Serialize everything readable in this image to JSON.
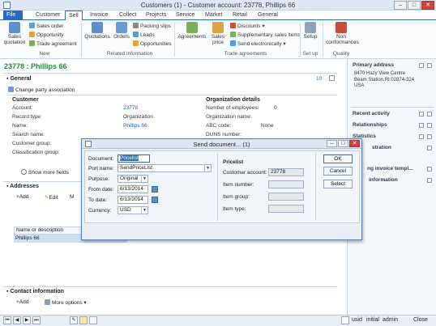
{
  "window": {
    "title": "Customers (1) - Customer account: 23778, Phillips 66",
    "min": "–",
    "max": "□",
    "close": "✕"
  },
  "ribbon_tabs": [
    "File",
    "Customer",
    "Sell",
    "Invoice",
    "Collect",
    "Projects",
    "Service",
    "Market",
    "Retail",
    "General"
  ],
  "ribbon": {
    "new": {
      "sales_quotation": "Sales quotation",
      "sales_order": "Sales order",
      "opportunity": "Opportunity",
      "trade_agreement": "Trade agreement",
      "label": "New"
    },
    "related": {
      "quotations": "Quotations",
      "orders": "Orders",
      "packing_slips": "Packing slips",
      "leads": "Leads",
      "opportunities": "Opportunities",
      "label": "Related information"
    },
    "trade": {
      "agreements": "Agreements",
      "sales_price": "Sales price",
      "discounts": "Discounts",
      "supplementary": "Supplementary sales items",
      "send_electronically": "Send electronically",
      "label": "Trade agreements"
    },
    "setup": {
      "setup": "Setup",
      "label": "Set up"
    },
    "quality": {
      "nonconf": "Non conformances",
      "label": "Quality"
    }
  },
  "record_heading": "23778 : Phillips 66",
  "general": {
    "title": "General",
    "count": "10",
    "change_party": "Change party association",
    "customer_hdr": "Customer",
    "org_hdr": "Organization details",
    "fields": [
      {
        "label": "Account:",
        "value": "23778"
      },
      {
        "label": "Record type:",
        "value": "Organization"
      },
      {
        "label": "Name:",
        "value": "Phillips 66"
      },
      {
        "label": "Search name:",
        "value": ""
      },
      {
        "label": "Customer group:",
        "value": ""
      },
      {
        "label": "Classification group:",
        "value": ""
      }
    ],
    "org_fields": [
      {
        "label": "Number of employees:",
        "value": "0"
      },
      {
        "label": "Organization name:",
        "value": ""
      },
      {
        "label": "ABC code:",
        "value": "None"
      },
      {
        "label": "DUNS number:",
        "value": ""
      }
    ],
    "show_more": "Show more fields"
  },
  "addresses": {
    "title": "Addresses",
    "add": "Add",
    "edit": "Edit",
    "more": "M",
    "col": "Name or description",
    "row": "Phillips 66"
  },
  "contact": {
    "title": "Contact information",
    "add": "Add",
    "more": "More options"
  },
  "right_pane": {
    "primary_address": "Primary address",
    "address_lines": [
      "8470 Hazy View Centre",
      "Beam Station,RI 02874-324",
      "USA"
    ],
    "items": [
      "Recent activity",
      "Relationships",
      "Statistics",
      "stration",
      "ng invoice templ...",
      "information"
    ]
  },
  "dialog": {
    "title": "Send document... (1)",
    "document_label": "Document:",
    "document_value": "Pricelist",
    "port_label": "Port name:",
    "port_value": "SendPriceList",
    "purpose_label": "Purpose:",
    "purpose_value": "Original",
    "from_label": "From date:",
    "from_value": "6/13/2014",
    "to_label": "To date:",
    "to_value": "6/13/2014",
    "currency_label": "Currency:",
    "currency_value": "USD",
    "pricelist_hdr": "Pricelist",
    "customer_account_label": "Customer account:",
    "customer_account_value": "23778",
    "item_number_label": "Item number:",
    "item_group_label": "Item group:",
    "item_type_label": "Item type:",
    "ok": "OK",
    "cancel": "Cancel",
    "select": "Select"
  },
  "status": {
    "user": "usid",
    "partition": "initial",
    "company": "admin",
    "close": "Close"
  }
}
